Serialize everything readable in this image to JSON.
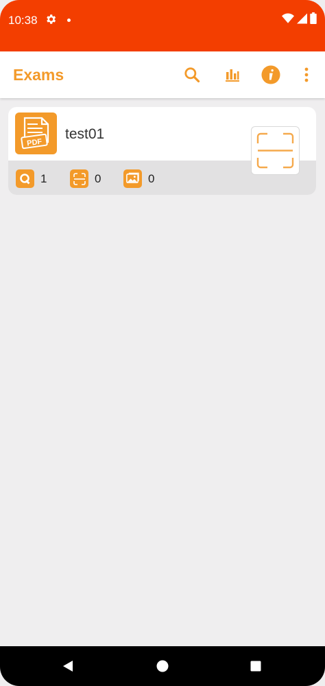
{
  "status_bar": {
    "time": "10:38"
  },
  "app_bar": {
    "title": "Exams"
  },
  "exam_list": [
    {
      "name": "test01",
      "stats": {
        "questions": "1",
        "scans": "0",
        "images": "0"
      }
    }
  ],
  "colors": {
    "status_bar": "#f33e00",
    "accent": "#f39a2a",
    "background": "#efeeef",
    "card_footer": "#e2e1e2"
  },
  "icons": {
    "status": [
      "gear-icon",
      "wifi-icon",
      "signal-icon",
      "battery-icon"
    ],
    "toolbar": [
      "search-icon",
      "stats-icon",
      "info-icon",
      "more-vert-icon"
    ],
    "nav": [
      "back-icon",
      "home-icon",
      "recents-icon"
    ]
  }
}
